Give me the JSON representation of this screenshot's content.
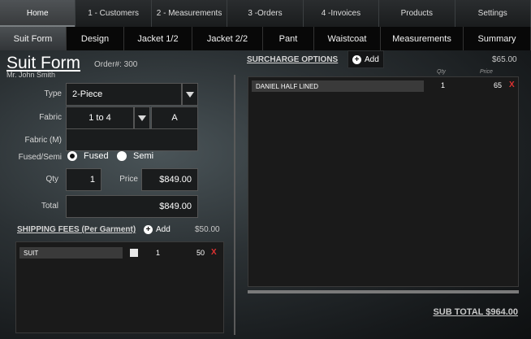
{
  "topnav": [
    {
      "label": "Home",
      "active": true
    },
    {
      "label": "1 - Customers"
    },
    {
      "label": "2 - Measurements"
    },
    {
      "label": "3 -Orders"
    },
    {
      "label": "4 -Invoices"
    },
    {
      "label": "Products"
    },
    {
      "label": "Settings"
    }
  ],
  "subnav": [
    {
      "label": "Suit Form",
      "active": true
    },
    {
      "label": "Design"
    },
    {
      "label": "Jacket 1/2"
    },
    {
      "label": "Jacket 2/2"
    },
    {
      "label": "Pant"
    },
    {
      "label": "Waistcoat"
    },
    {
      "label": "Measurements"
    },
    {
      "label": "Summary"
    }
  ],
  "form": {
    "title": "Suit Form",
    "order_no": "Order#: 300",
    "customer": "Mr. John Smith",
    "type_label": "Type",
    "type_value": "2-Piece",
    "fabric_label": "Fabric",
    "fabric_value": "1 to 4",
    "fabric_grade": "A",
    "fabric_m_label": "Fabric (M)",
    "fabric_m_value": "",
    "fused_label": "Fused/Semi",
    "fused_option": "Fused",
    "semi_option": "Semi",
    "qty_label": "Qty",
    "qty_value": "1",
    "price_label": "Price",
    "price_value": "$849.00",
    "total_label": "Total",
    "total_value": "$849.00"
  },
  "shipping": {
    "heading": "SHIPPING FEES (Per Garment)",
    "add_label": "Add",
    "amount": "$50.00",
    "rows": [
      {
        "name": "SUIT",
        "qty": "1",
        "price": "50",
        "remove": "X"
      }
    ]
  },
  "surcharge": {
    "heading": "SURCHARGE OPTIONS",
    "add_label": "Add",
    "amount": "$65.00",
    "col_qty": "Qty",
    "col_price": "Price",
    "rows": [
      {
        "name": "DANIEL HALF LINED",
        "qty": "1",
        "price": "65",
        "remove": "X"
      }
    ]
  },
  "subtotal": "SUB TOTAL $964.00",
  "icons": {
    "dropdown": "triangle-down-icon",
    "add": "plus-circle-icon",
    "remove": "x-icon"
  },
  "colors": {
    "remove": "#e03232",
    "tab_active": "#4f5356"
  }
}
